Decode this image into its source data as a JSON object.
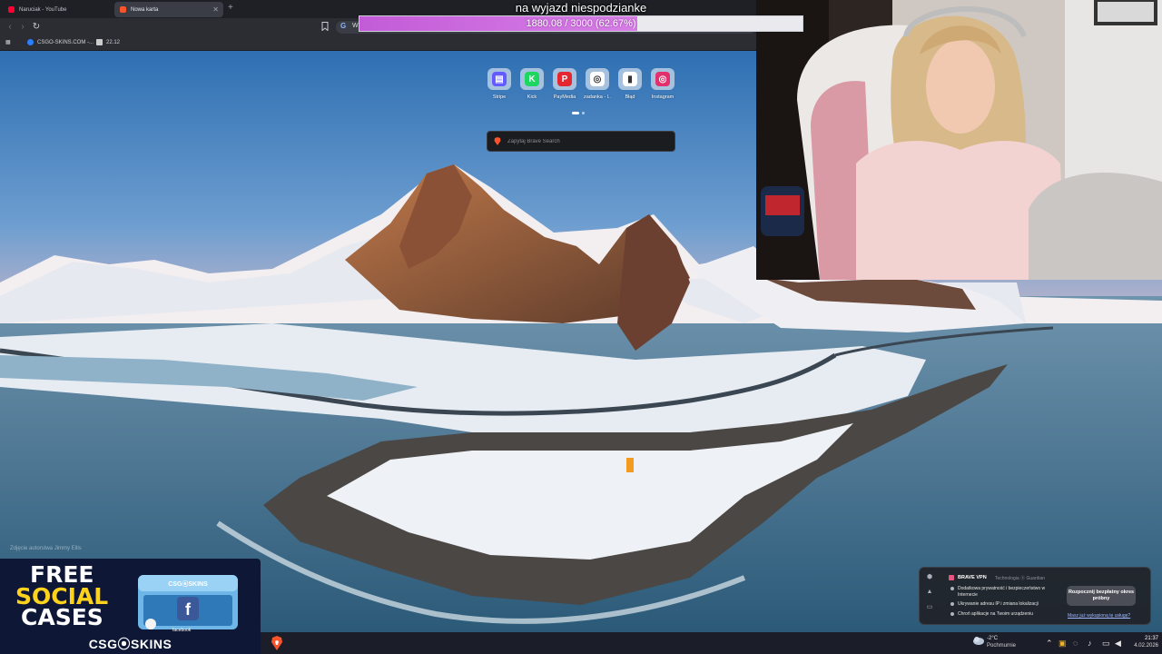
{
  "browser": {
    "tabs": [
      {
        "label": "Naruciak - YouTube",
        "active": false,
        "favicon_color": "#ff0033"
      },
      {
        "label": "Nowa karta",
        "active": true,
        "favicon_color": "#fb542b"
      }
    ],
    "address_text": "W",
    "bookmarks": [
      {
        "label": "CSGO-SKINS.COM -...",
        "icon_color": "#2a7fff"
      },
      {
        "label": "22.12",
        "icon_color": "#cccccc"
      }
    ]
  },
  "goal": {
    "title": "na wyjazd niespodzianke",
    "progress_text": "1880.08 / 3000 (62.67%)",
    "current": 1880.08,
    "target": 3000,
    "fill_fraction": 0.6267,
    "fill_color": "#c35bd8"
  },
  "newtab": {
    "shortcuts": [
      {
        "label": "Stripe",
        "icon": "stripe-icon",
        "color": "#635bff",
        "glyph": "▤"
      },
      {
        "label": "Kick",
        "icon": "kick-icon",
        "color": "#1ed760",
        "glyph": "K"
      },
      {
        "label": "PayMedia",
        "icon": "paymedia-icon",
        "color": "#e3262f",
        "glyph": "P"
      },
      {
        "label": "zadanka - l...",
        "icon": "zadanka-icon",
        "color": "#ffffff",
        "glyph": "◎"
      },
      {
        "label": "Błąd",
        "icon": "chart-icon",
        "color": "#ffffff",
        "glyph": "▮"
      },
      {
        "label": "Instagram",
        "icon": "instagram-icon",
        "color": "#e1306c",
        "glyph": "◎"
      }
    ],
    "search_placeholder": "Zapytaj Brave Search",
    "photo_credit": "Zdjęcie autorstwa Jimmy Ellis"
  },
  "ad": {
    "line1": "FREE",
    "line2": "SOCIAL",
    "line3": "CASES",
    "brand": "CSG⦿SKINS",
    "chest_label": "CSG⦿SKINS",
    "chest_sub": "facebook",
    "accent": "#ffd21e"
  },
  "vpn": {
    "title": "BRAVE VPN",
    "by": "Technologia ⓖ Guardian",
    "items": [
      "Dodatkowa prywatność i bezpieczeństwo w Internecie",
      "Ukrywanie adresu IP i zmiana lokalizacji",
      "Chroń aplikacje na Twoim urządzeniu"
    ],
    "cta": "Rozpocznij bezpłatny okres próbny",
    "link": "Masz już wykupioną tę usługę?"
  },
  "taskbar": {
    "temperature": "-2°C",
    "weather": "Pochmurnie",
    "time": "21:37",
    "date": "4.02.2026"
  }
}
